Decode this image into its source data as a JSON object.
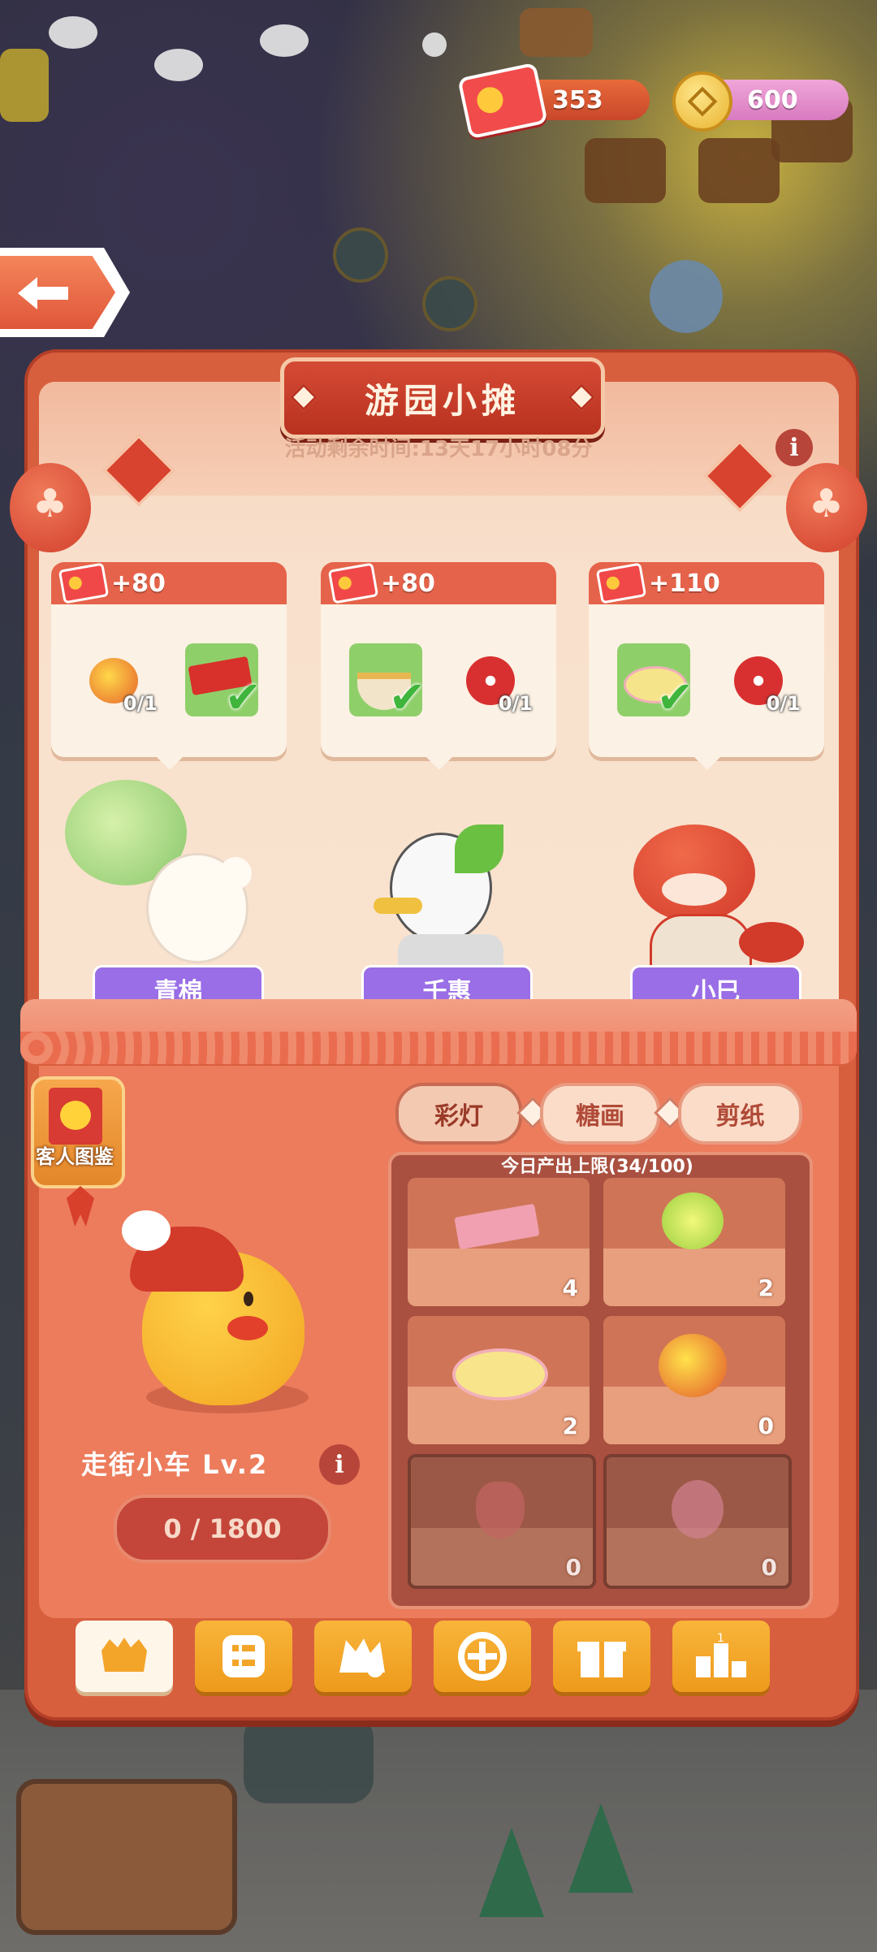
{
  "currency": {
    "tickets": "353",
    "coins": "600"
  },
  "header": {
    "title": "游园小摊",
    "timer": "活动剩余时间:13天17小时08分"
  },
  "orders": [
    {
      "reward": "+80",
      "items": [
        {
          "name": "lantern",
          "count": "0/1",
          "done": false
        },
        {
          "name": "papercut-red",
          "done": true
        }
      ]
    },
    {
      "reward": "+80",
      "items": [
        {
          "name": "soup-bowl",
          "done": true
        },
        {
          "name": "red-flower",
          "count": "0/1",
          "done": false
        }
      ]
    },
    {
      "reward": "+110",
      "items": [
        {
          "name": "turtle-candy",
          "done": true
        },
        {
          "name": "red-flower",
          "count": "0/1",
          "done": false
        }
      ]
    }
  ],
  "guests": [
    {
      "name": "青棉"
    },
    {
      "name": "千惠"
    },
    {
      "name": "小巳"
    }
  ],
  "guest_book": {
    "label": "客人图鉴"
  },
  "cart": {
    "name": "走街小车 Lv.2",
    "progress": "0 / 1800"
  },
  "tabs": [
    {
      "label": "彩灯",
      "active": true
    },
    {
      "label": "糖画",
      "active": false
    },
    {
      "label": "剪纸",
      "active": false
    }
  ],
  "production": {
    "title": "今日产出上限(34/100)",
    "slots": [
      {
        "item": "paper-stack",
        "count": "4",
        "locked": false
      },
      {
        "item": "clover-lamp",
        "count": "2",
        "locked": false
      },
      {
        "item": "turtle-candy",
        "count": "2",
        "locked": false
      },
      {
        "item": "gold-lantern",
        "count": "0",
        "locked": false
      },
      {
        "item": "lotus-lamp",
        "count": "0",
        "locked": true
      },
      {
        "item": "pink-lamp",
        "count": "0",
        "locked": true
      }
    ]
  },
  "nav": [
    {
      "icon": "shop-icon",
      "active": true
    },
    {
      "icon": "list-icon",
      "active": false
    },
    {
      "icon": "ingredients-icon",
      "active": false
    },
    {
      "icon": "upgrade-icon",
      "active": false
    },
    {
      "icon": "gift-icon",
      "active": false
    },
    {
      "icon": "ranking-icon",
      "active": false
    }
  ],
  "colors": {
    "panel": "#d85f3e",
    "title_banner": "#b8321f",
    "name_tag": "#9a6ee6",
    "nav_button": "#f8b53a"
  }
}
